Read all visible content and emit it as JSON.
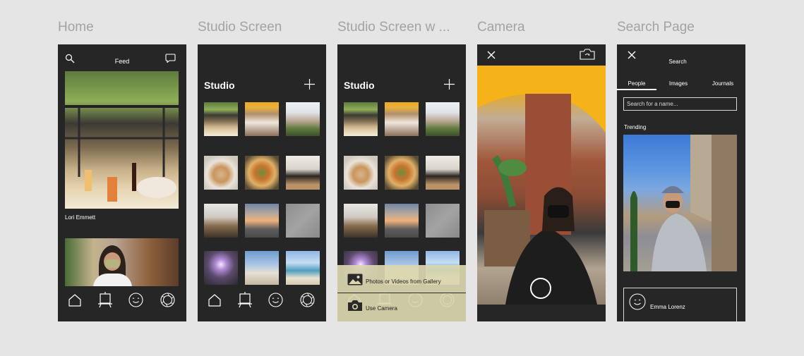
{
  "frames": {
    "home": {
      "title": "Home",
      "header_title": "Feed",
      "post_author": "Lori Emmett"
    },
    "studio": {
      "title": "Studio Screen",
      "header_title": "Studio"
    },
    "studio_menu": {
      "title": "Studio Screen w ...",
      "header_title": "Studio",
      "menu_gallery_label": "Photos or Videos from Gallery",
      "menu_camera_label": "Use Camera"
    },
    "camera": {
      "title": "Camera"
    },
    "search": {
      "title": "Search Page",
      "header_title": "Search",
      "tabs": [
        "People",
        "Images",
        "Journals"
      ],
      "active_tab": "People",
      "search_placeholder": "Search for a name...",
      "section_label": "Trending",
      "result_name": "Emma Lorenz"
    }
  },
  "icons": {
    "search": "search-icon",
    "message": "message-icon",
    "add": "plus-icon",
    "close": "close-icon",
    "flip_camera": "camera-flip-icon",
    "nav": [
      "home-icon",
      "easel-icon",
      "smiley-icon",
      "aperture-icon"
    ],
    "gallery": "image-icon",
    "camera": "camera-icon",
    "avatar": "smiley-avatar-icon"
  },
  "colors": {
    "canvas": "#e5e5e5",
    "phone_bg": "#262626",
    "frame_title": "#a3a3a3",
    "text": "#ffffff",
    "menu_overlay": "#dbd7af"
  }
}
